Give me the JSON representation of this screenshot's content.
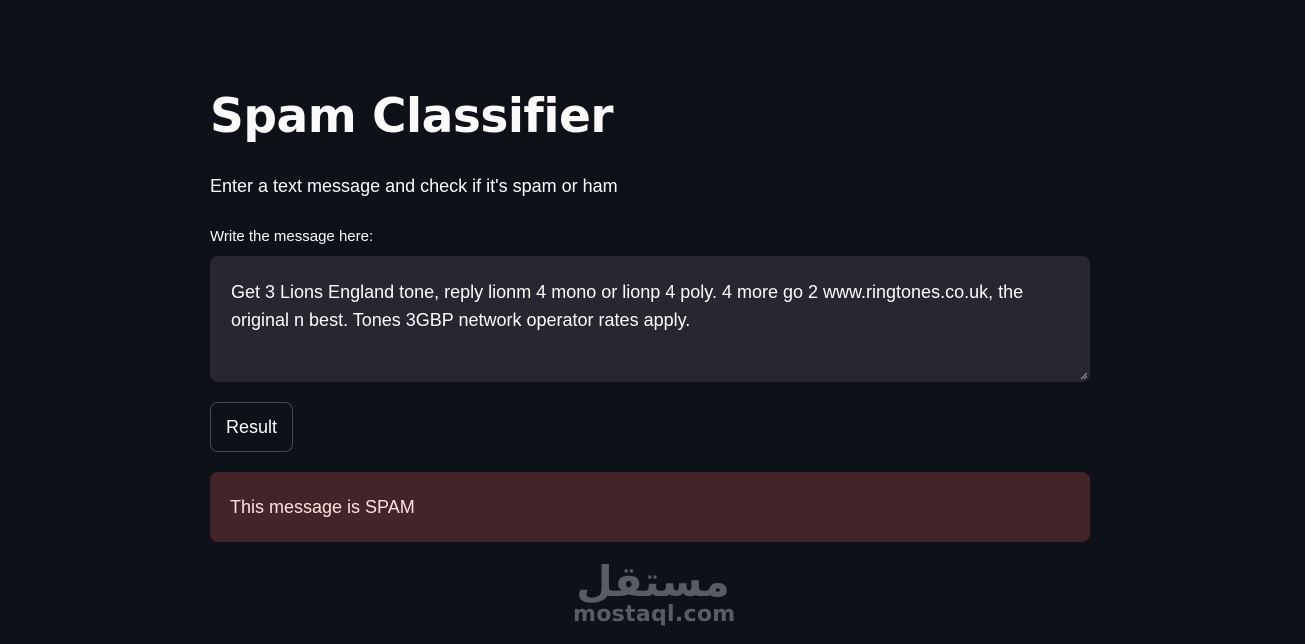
{
  "app": {
    "title": "Spam Classifier",
    "subtitle": "Enter a text message and check if it's spam or ham"
  },
  "form": {
    "label": "Write the message here:",
    "message": "Get 3 Lions England tone, reply lionm 4 mono or lionp 4 poly. 4 more go 2 www.ringtones.co.uk, the original n best. Tones 3GBP network operator rates apply.",
    "button_label": "Result"
  },
  "result": {
    "text": "This message is SPAM"
  },
  "watermark": {
    "latin": "mostaql.com",
    "arabic": "مستقل"
  },
  "colors": {
    "background": "#0e1117",
    "textarea": "#262730",
    "alert_bg": "#432428",
    "alert_text": "#ffdede",
    "watermark": "#5a5c63"
  }
}
